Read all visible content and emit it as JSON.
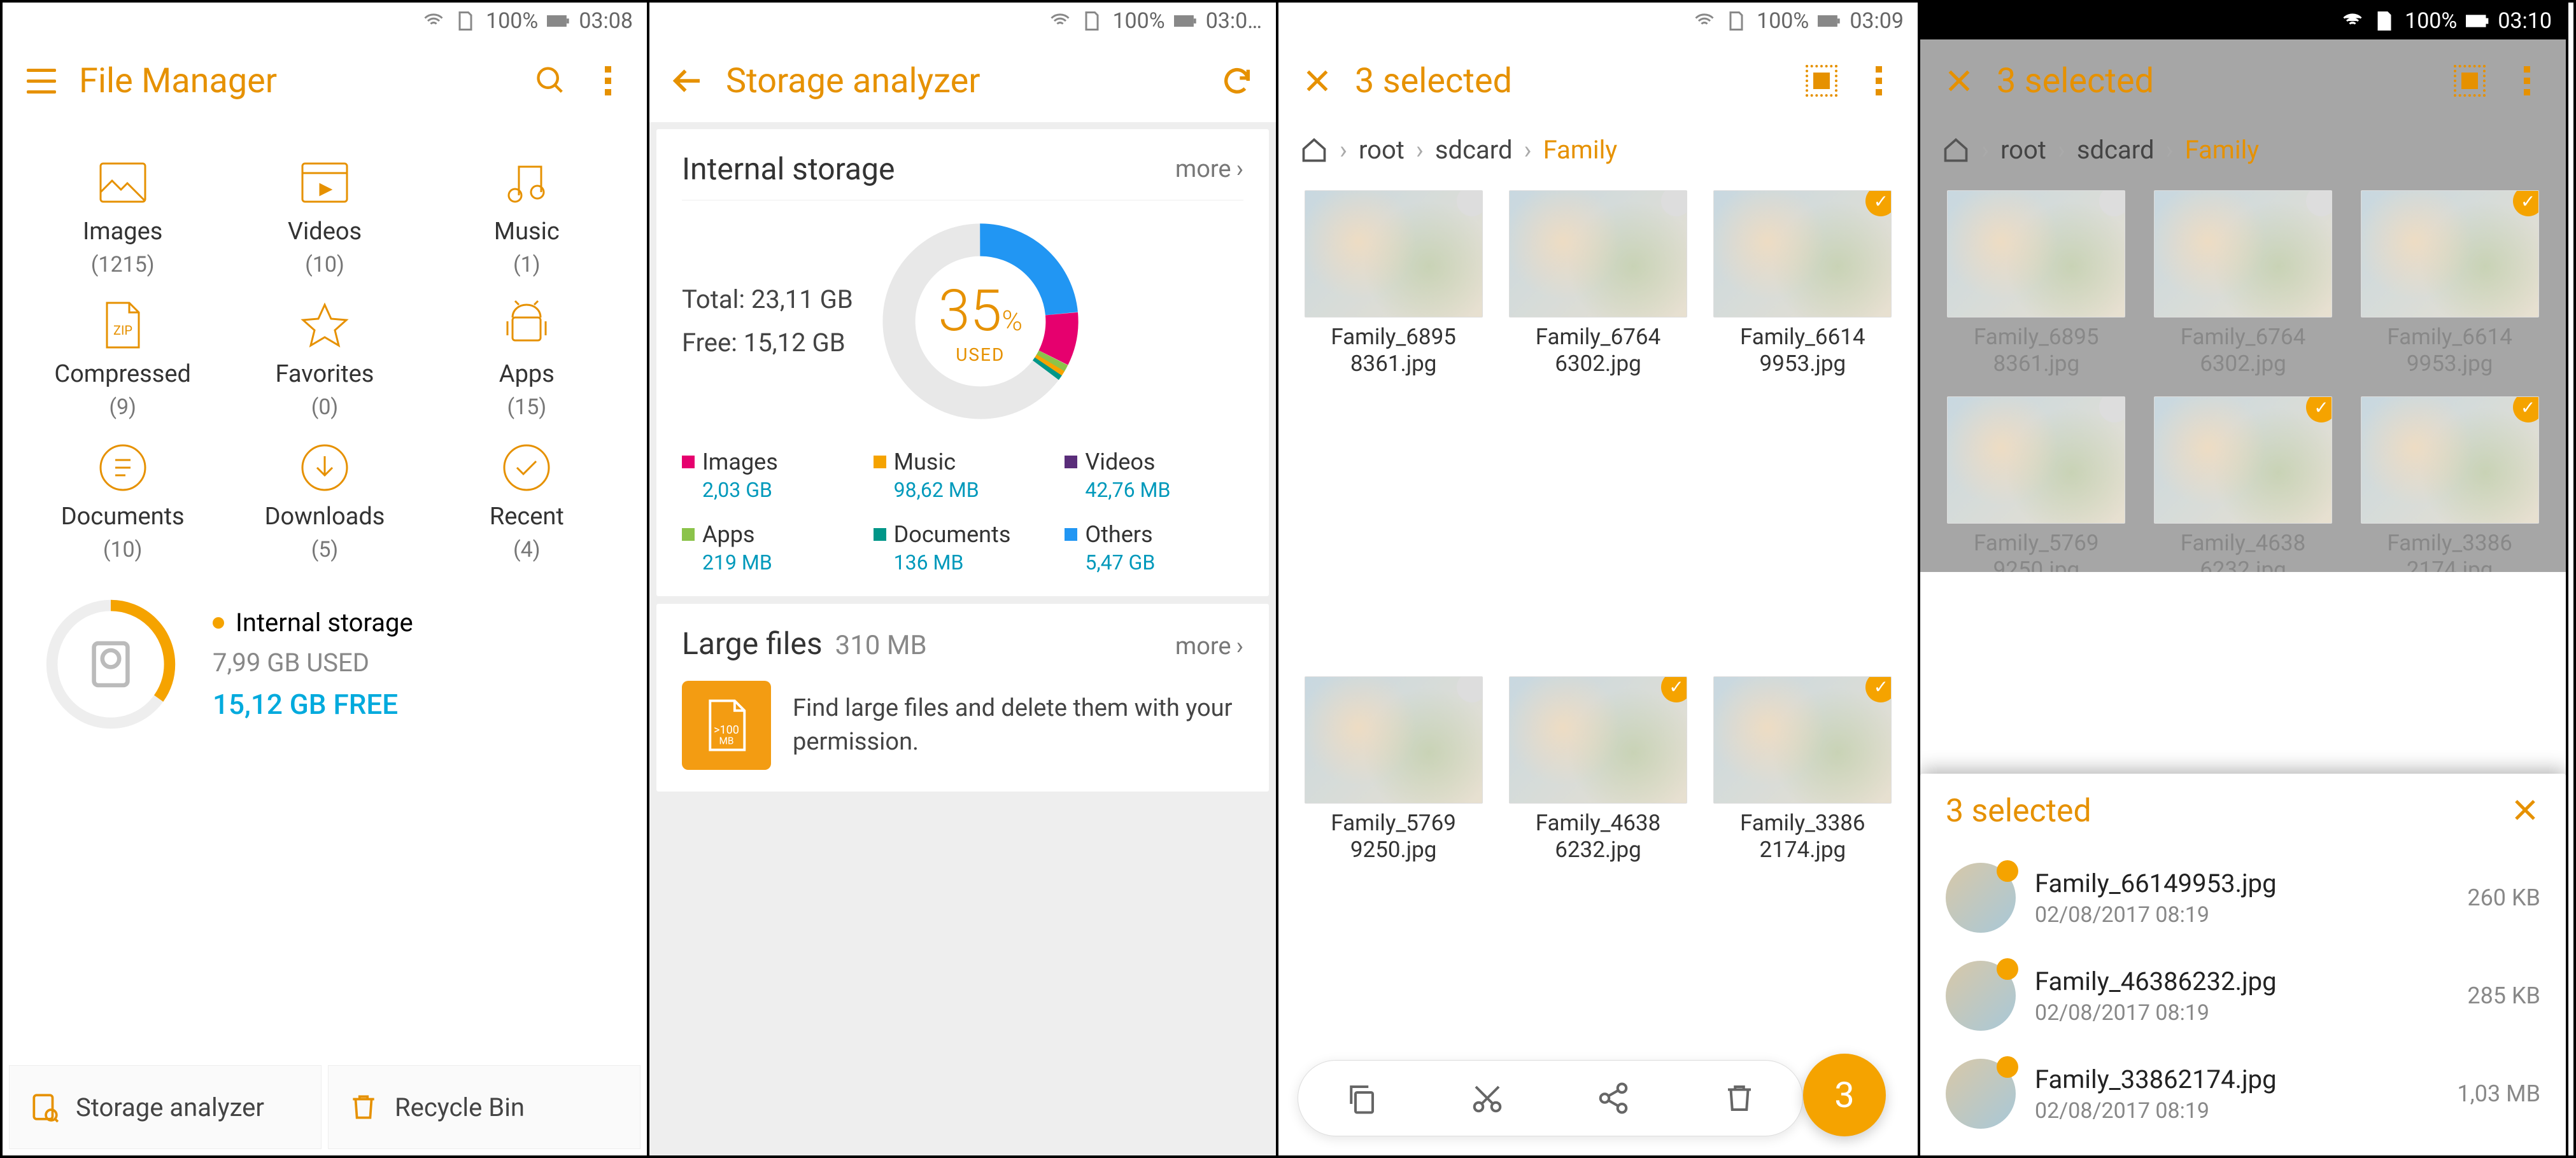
{
  "status": {
    "battery": "100%",
    "time1": "03:08",
    "time2": "03:0…",
    "time3": "03:09",
    "time4": "03:10"
  },
  "screen1": {
    "title": "File Manager",
    "categories": [
      {
        "label": "Images",
        "count": "(1215)"
      },
      {
        "label": "Videos",
        "count": "(10)"
      },
      {
        "label": "Music",
        "count": "(1)"
      },
      {
        "label": "Compressed",
        "count": "(9)"
      },
      {
        "label": "Favorites",
        "count": "(0)"
      },
      {
        "label": "Apps",
        "count": "(15)"
      },
      {
        "label": "Documents",
        "count": "(10)"
      },
      {
        "label": "Downloads",
        "count": "(5)"
      },
      {
        "label": "Recent",
        "count": "(4)"
      }
    ],
    "storage": {
      "name": "Internal storage",
      "used": "7,99 GB USED",
      "free": "15,12 GB FREE"
    },
    "tiles": {
      "analyzer": "Storage analyzer",
      "recycle": "Recycle Bin"
    }
  },
  "screen2": {
    "title": "Storage analyzer",
    "internal": {
      "heading": "Internal storage",
      "more": "more",
      "total_label": "Total: 23,11 GB",
      "free_label": "Free: 15,12 GB",
      "pct": "35",
      "pct_unit": "%",
      "used_label": "USED",
      "legend": [
        {
          "name": "Images",
          "val": "2,03 GB",
          "color": "#e6006e"
        },
        {
          "name": "Music",
          "val": "98,62 MB",
          "color": "#f5a300"
        },
        {
          "name": "Videos",
          "val": "42,76 MB",
          "color": "#5a2d7a"
        },
        {
          "name": "Apps",
          "val": "219 MB",
          "color": "#8bc34a"
        },
        {
          "name": "Documents",
          "val": "136 MB",
          "color": "#009688"
        },
        {
          "name": "Others",
          "val": "5,47 GB",
          "color": "#2196f3"
        }
      ]
    },
    "large": {
      "heading": "Large files",
      "size": "310 MB",
      "more": "more",
      "desc": "Find large files and delete them with your permission."
    }
  },
  "screen3": {
    "title": "3 selected",
    "crumbs": {
      "root": "root",
      "sdcard": "sdcard",
      "family": "Family"
    },
    "files": [
      {
        "name": "Family_68958361.jpg",
        "sel": false
      },
      {
        "name": "Family_67646302.jpg",
        "sel": false
      },
      {
        "name": "Family_66149953.jpg",
        "sel": true
      },
      {
        "name": "Family_57699250.jpg",
        "sel": false
      },
      {
        "name": "Family_46386232.jpg",
        "sel": true
      },
      {
        "name": "Family_33862174.jpg",
        "sel": true
      }
    ],
    "fab": "3"
  },
  "screen4": {
    "title": "3 selected",
    "crumbs": {
      "root": "root",
      "sdcard": "sdcard",
      "family": "Family"
    },
    "sheet_title": "3 selected",
    "items": [
      {
        "name": "Family_66149953.jpg",
        "date": "02/08/2017 08:19",
        "size": "260 KB"
      },
      {
        "name": "Family_46386232.jpg",
        "date": "02/08/2017 08:19",
        "size": "285 KB"
      },
      {
        "name": "Family_33862174.jpg",
        "date": "02/08/2017 08:19",
        "size": "1,03 MB"
      }
    ]
  },
  "chart_data": {
    "type": "pie",
    "title": "Internal storage usage",
    "total_gb": 23.11,
    "free_gb": 15.12,
    "used_pct": 35,
    "series": [
      {
        "name": "Images",
        "value": 2.03,
        "unit": "GB",
        "color": "#e6006e"
      },
      {
        "name": "Music",
        "value": 98.62,
        "unit": "MB",
        "color": "#f5a300"
      },
      {
        "name": "Videos",
        "value": 42.76,
        "unit": "MB",
        "color": "#5a2d7a"
      },
      {
        "name": "Apps",
        "value": 219,
        "unit": "MB",
        "color": "#8bc34a"
      },
      {
        "name": "Documents",
        "value": 136,
        "unit": "MB",
        "color": "#009688"
      },
      {
        "name": "Others",
        "value": 5.47,
        "unit": "GB",
        "color": "#2196f3"
      },
      {
        "name": "Free",
        "value": 15.12,
        "unit": "GB",
        "color": "#e0e0e0"
      }
    ]
  }
}
